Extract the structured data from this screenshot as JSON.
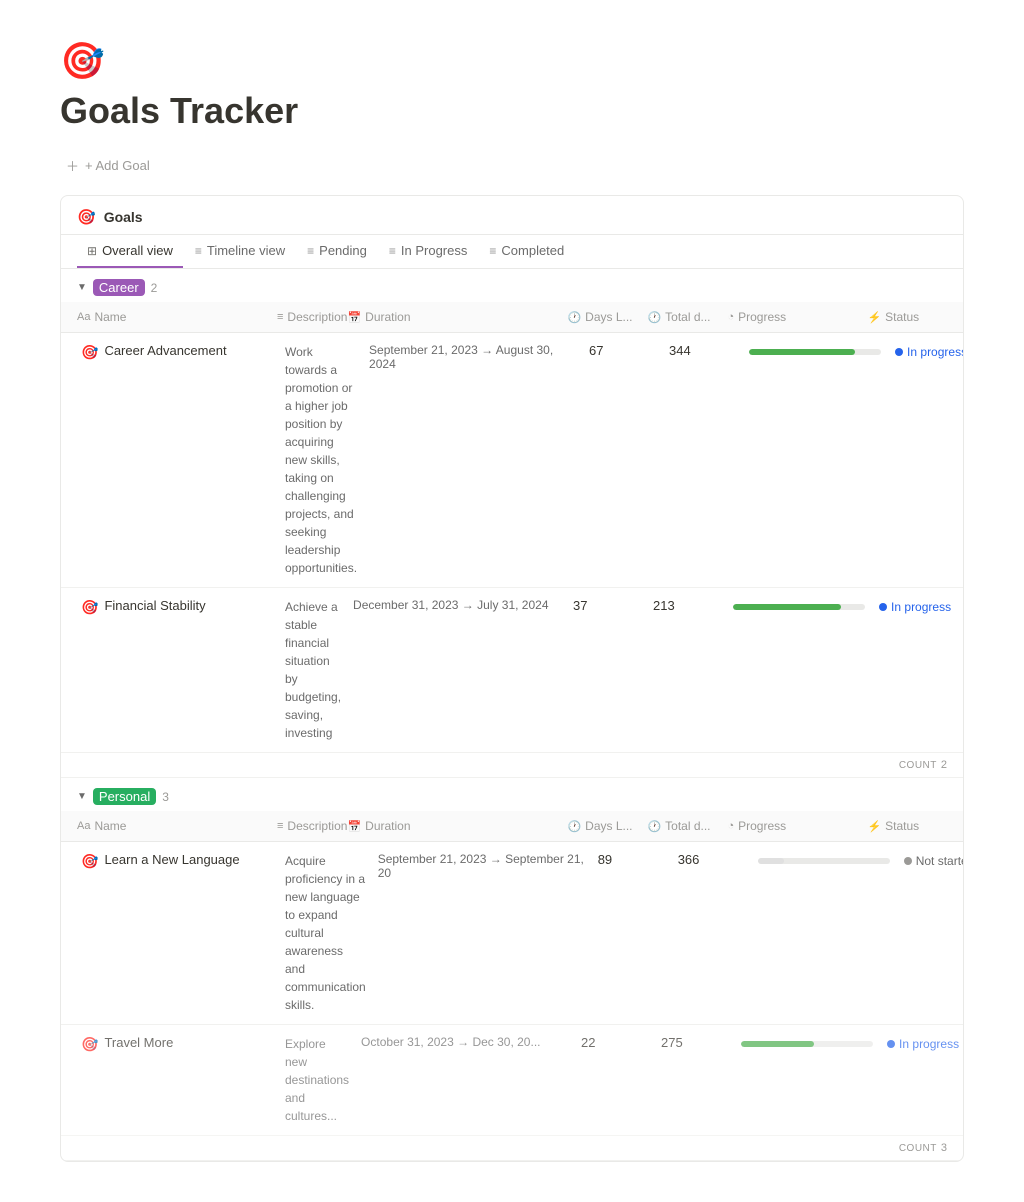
{
  "page": {
    "icon": "🎯",
    "title": "Goals Tracker",
    "add_goal_label": "+ Add Goal"
  },
  "database": {
    "title": "Goals",
    "tabs": [
      {
        "id": "overall",
        "label": "Overall view",
        "icon": "⊞",
        "active": true
      },
      {
        "id": "timeline",
        "label": "Timeline view",
        "icon": "≡",
        "active": false
      },
      {
        "id": "pending",
        "label": "Pending",
        "icon": "≡",
        "active": false
      },
      {
        "id": "in-progress",
        "label": "In Progress",
        "icon": "≡",
        "active": false
      },
      {
        "id": "completed",
        "label": "Completed",
        "icon": "≡",
        "active": false
      }
    ],
    "groups": [
      {
        "id": "career",
        "label": "Career",
        "color": "career",
        "count": 2,
        "columns": [
          {
            "id": "name",
            "icon": "Aa",
            "label": "Name"
          },
          {
            "id": "description",
            "icon": "≡",
            "label": "Description"
          },
          {
            "id": "duration",
            "icon": "📅",
            "label": "Duration"
          },
          {
            "id": "days_left",
            "icon": "🕐",
            "label": "Days L..."
          },
          {
            "id": "total_d",
            "icon": "🕐",
            "label": "Total d..."
          },
          {
            "id": "progress",
            "icon": "◔",
            "label": "Progress"
          },
          {
            "id": "status",
            "icon": "⚡",
            "label": "Status"
          }
        ],
        "rows": [
          {
            "name": "Career Advancement",
            "description": "Work towards a promotion or a higher job position by acquiring new skills, taking on challenging projects, and seeking leadership opportunities.",
            "duration": "September 21, 2023 → August 30, 2024",
            "days_left": "67",
            "total_d": "344",
            "progress_pct": 80,
            "status": "In progress",
            "status_type": "in-progress"
          },
          {
            "name": "Financial Stability",
            "description": "Achieve a stable financial situation by budgeting, saving, investing",
            "duration": "December 31, 2023 → July 31, 2024",
            "days_left": "37",
            "total_d": "213",
            "progress_pct": 82,
            "status": "In progress",
            "status_type": "in-progress"
          }
        ],
        "count_label": "COUNT",
        "count_value": "2"
      },
      {
        "id": "personal",
        "label": "Personal",
        "color": "personal",
        "count": 3,
        "columns": [
          {
            "id": "name",
            "icon": "Aa",
            "label": "Name"
          },
          {
            "id": "description",
            "icon": "≡",
            "label": "Description"
          },
          {
            "id": "duration",
            "icon": "📅",
            "label": "Duration"
          },
          {
            "id": "days_left",
            "icon": "🕐",
            "label": "Days L..."
          },
          {
            "id": "total_d",
            "icon": "🕐",
            "label": "Total d..."
          },
          {
            "id": "progress",
            "icon": "◔",
            "label": "Progress"
          },
          {
            "id": "status",
            "icon": "⚡",
            "label": "Status"
          }
        ],
        "rows": [
          {
            "name": "Learn a New Language",
            "description": "Acquire proficiency in a new language to expand cultural awareness and communication skills.",
            "duration": "September 21, 2023 → September 21, 20",
            "days_left": "89",
            "total_d": "366",
            "progress_pct": 20,
            "status": "Not started",
            "status_type": "not-started"
          },
          {
            "name": "Travel More",
            "description": "Explore new destinations and cultures...",
            "duration": "October 31, 2023 → Dec 30, 20...",
            "days_left": "22",
            "total_d": "275",
            "progress_pct": 55,
            "status": "In progress",
            "status_type": "in-progress"
          }
        ],
        "count_label": "COUNT",
        "count_value": "3"
      }
    ]
  }
}
